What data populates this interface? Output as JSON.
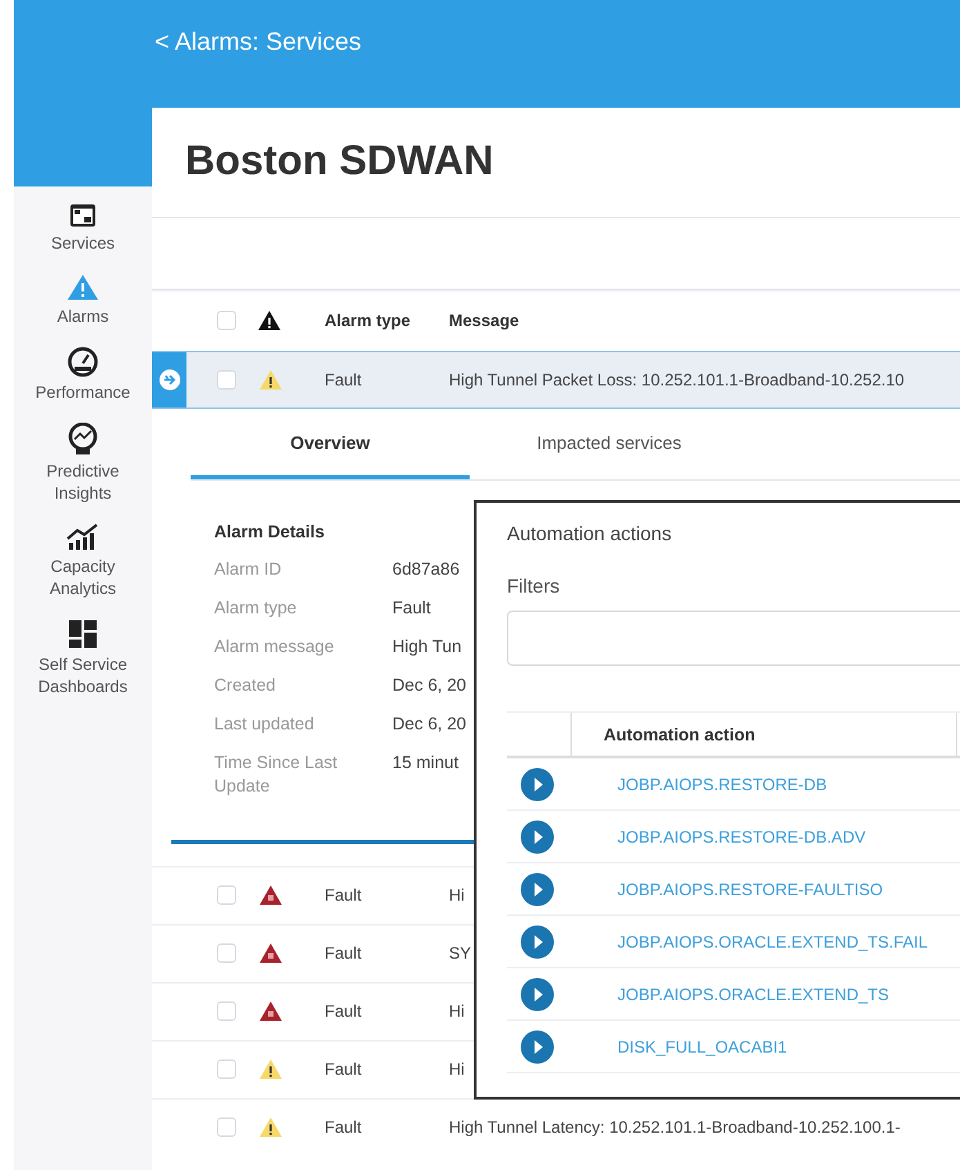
{
  "header": {
    "back_link": "< Alarms: Services"
  },
  "sidebar": {
    "items": [
      {
        "label": "Services",
        "selected": false
      },
      {
        "label": "Alarms",
        "selected": true
      },
      {
        "label": "Performance",
        "selected": false
      },
      {
        "label": "Predictive Insights",
        "selected": false
      },
      {
        "label": "Capacity Analytics",
        "selected": false
      },
      {
        "label": "Self Service Dashboards",
        "selected": false
      }
    ]
  },
  "page_title": "Boston SDWAN",
  "table": {
    "select_all_checked": false,
    "columns": [
      "Alarm type",
      "Message"
    ],
    "expanded_row": {
      "type": "Fault",
      "message": "High Tunnel Packet Loss: 10.252.101.1-Broadband-10.252.10",
      "kind": "minor",
      "checked": false,
      "selected": true
    },
    "tabs": [
      {
        "label": "Overview",
        "selected": true
      },
      {
        "label": "Impacted services",
        "selected": false
      }
    ],
    "details": {
      "title": "Alarm Details",
      "fields": [
        {
          "label": "Alarm ID",
          "value": "6d87a86"
        },
        {
          "label": "Alarm type",
          "value": "Fault"
        },
        {
          "label": "Alarm message",
          "value": "High Tun"
        },
        {
          "label": "Created",
          "value": "Dec 6, 20"
        },
        {
          "label": "Last updated",
          "value": "Dec 6, 20"
        },
        {
          "label": "Time Since Last Update",
          "value": "15 minut"
        }
      ]
    },
    "rows": [
      {
        "type": "Fault",
        "message": "Hi",
        "kind": "critical",
        "checked": false,
        "selected": false
      },
      {
        "type": "Fault",
        "message": "SY",
        "kind": "critical",
        "checked": false,
        "selected": false
      },
      {
        "type": "Fault",
        "message": "Hi",
        "kind": "critical",
        "checked": false,
        "selected": false
      },
      {
        "type": "Fault",
        "message": "Hi",
        "kind": "minor",
        "checked": false,
        "selected": false
      },
      {
        "type": "Fault",
        "message": "High Tunnel Latency: 10.252.101.1-Broadband-10.252.100.1-",
        "kind": "minor",
        "checked": false,
        "selected": false
      }
    ]
  },
  "automation_dialog": {
    "title": "Automation actions",
    "filters_label": "Filters",
    "column": "Automation action",
    "actions": [
      "JOBP.AIOPS.RESTORE-DB",
      "JOBP.AIOPS.RESTORE-DB.ADV",
      "JOBP.AIOPS.RESTORE-FAULTISO",
      "JOBP.AIOPS.ORACLE.EXTEND_TS.FAIL",
      "JOBP.AIOPS.ORACLE.EXTEND_TS",
      "DISK_FULL_OACABI1"
    ]
  }
}
